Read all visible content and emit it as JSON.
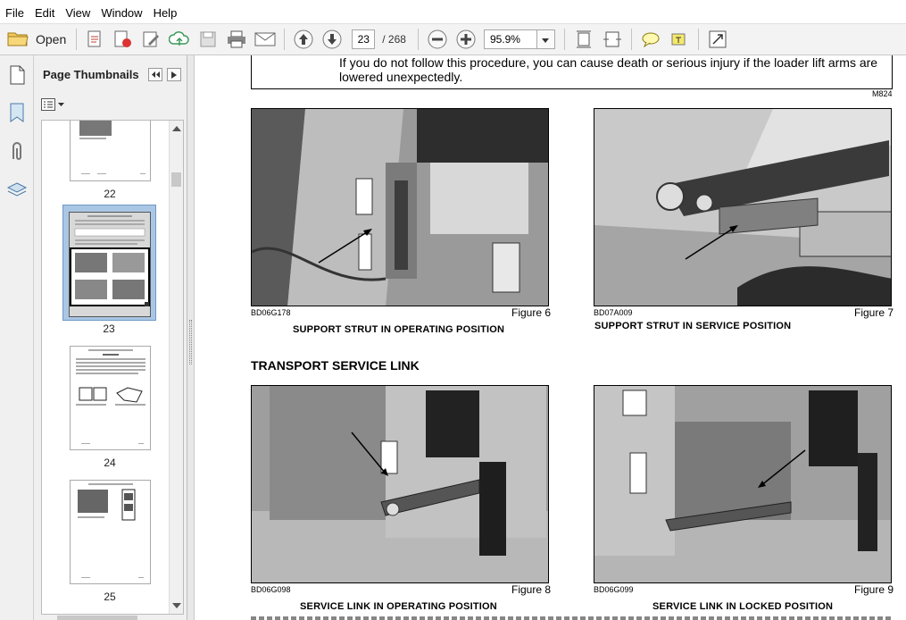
{
  "menu": [
    "File",
    "Edit",
    "View",
    "Window",
    "Help"
  ],
  "toolbar": {
    "open_label": "Open",
    "current_page": "23",
    "total_pages": "/ 268",
    "zoom": "95.9%"
  },
  "nav": {
    "title": "Page Thumbnails",
    "thumbnails": [
      {
        "label": "22"
      },
      {
        "label": "23"
      },
      {
        "label": "24"
      },
      {
        "label": "25"
      }
    ]
  },
  "document": {
    "warning_text": "If you do not follow this procedure, you can cause death or serious injury if the loader lift arms are lowered unexpectedly.",
    "warning_code": "M824",
    "section_heading": "TRANSPORT SERVICE LINK",
    "figures": [
      {
        "code": "BD06G178",
        "label": "Figure 6",
        "caption": "SUPPORT STRUT IN OPERATING POSITION"
      },
      {
        "code": "BD07A009",
        "label": "Figure 7",
        "caption": "SUPPORT STRUT IN SERVICE POSITION"
      },
      {
        "code": "BD06G098",
        "label": "Figure 8",
        "caption": "SERVICE LINK IN OPERATING POSITION"
      },
      {
        "code": "BD06G099",
        "label": "Figure 9",
        "caption": "SERVICE LINK IN LOCKED POSITION"
      }
    ]
  }
}
